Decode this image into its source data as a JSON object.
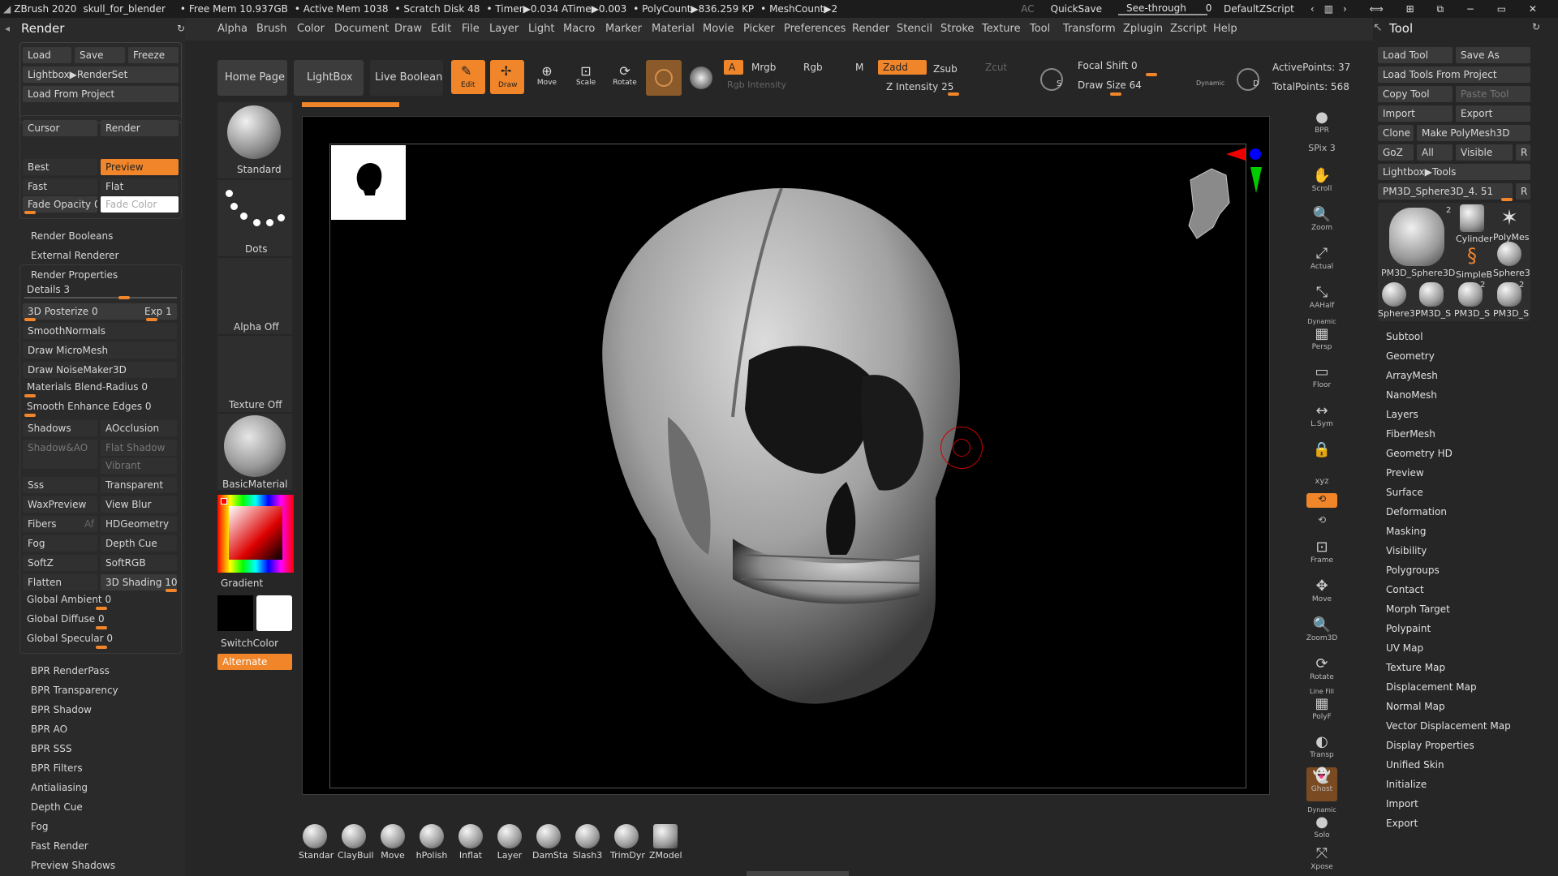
{
  "titlebar": {
    "items": [
      "ZBrush 2020",
      "skull_for_blender",
      "• Free Mem 10.937GB",
      "• Active Mem 1038",
      "• Scratch Disk 48",
      "• Timer▶0.034 ATime▶0.003",
      "• PolyCount▶836.259 KP",
      "• MeshCount▶2"
    ],
    "right": {
      "ac": "AC",
      "quicksave": "QuickSave",
      "see_through": "See-through",
      "see_through_val": "0",
      "script": "DefaultZScript"
    }
  },
  "menubar": [
    "Alpha",
    "Brush",
    "Color",
    "Document",
    "Draw",
    "Edit",
    "File",
    "Layer",
    "Light",
    "Macro",
    "Marker",
    "Material",
    "Movie",
    "Picker",
    "Preferences",
    "Render",
    "Stencil",
    "Stroke",
    "Texture",
    "Tool",
    "Transform",
    "Zplugin",
    "Zscript",
    "Help"
  ],
  "render_panel": {
    "title": "Render",
    "row1": [
      "Load",
      "Save",
      "Freeze"
    ],
    "lightbox": "Lightbox▶RenderSet",
    "load_from_project": "Load From Project",
    "cursor": "Cursor",
    "render": "Render",
    "best": "Best",
    "preview": "Preview",
    "fast": "Fast",
    "flat": "Flat",
    "fade_opacity": "Fade Opacity 0",
    "fade_color": "Fade Color",
    "render_booleans": "Render Booleans",
    "external_renderer": "External Renderer",
    "render_properties": "Render Properties",
    "details": "Details 3",
    "posterize": "3D Posterize 0",
    "exp": "Exp 1",
    "smooth_normals": "SmoothNormals",
    "draw_micromesh": "Draw MicroMesh",
    "draw_noisemaker": "Draw NoiseMaker3D",
    "materials_blend": "Materials Blend-Radius 0",
    "smooth_enhance": "Smooth Enhance Edges 0",
    "shadows": "Shadows",
    "aocclusion": "AOcclusion",
    "shadow_ao": "Shadow&AO",
    "flat_shadow": "Flat Shadow",
    "vibrant": "Vibrant",
    "sss": "Sss",
    "transparent": "Transparent",
    "waxpreview": "WaxPreview",
    "view_blur": "View Blur",
    "fibers": "Fibers",
    "af": "Af",
    "hdgeometry": "HDGeometry",
    "fog": "Fog",
    "depth_cue": "Depth Cue",
    "softz": "SoftZ",
    "softrgb": "SoftRGB",
    "flatten": "Flatten",
    "shading": "3D Shading 100",
    "global_ambient": "Global Ambient 0",
    "global_diffuse": "Global Diffuse 0",
    "global_specular": "Global Specular 0",
    "sections": [
      "BPR RenderPass",
      "BPR Transparency",
      "BPR Shadow",
      "BPR AO",
      "BPR SSS",
      "BPR Filters",
      "Antialiasing",
      "Depth Cue",
      "Fog",
      "Fast Render",
      "Preview Shadows"
    ]
  },
  "shelf": {
    "home": "Home Page",
    "lightbox": "LightBox",
    "live_boolean": "Live Boolean",
    "edit": "Edit",
    "draw": "Draw",
    "move": "Move",
    "scale": "Scale",
    "rotate": "Rotate",
    "a": "A",
    "mrgb": "Mrgb",
    "rgb": "Rgb",
    "m": "M",
    "zadd": "Zadd",
    "zsub": "Zsub",
    "zcut": "Zcut",
    "rgb_intensity": "Rgb Intensity",
    "z_intensity": "Z Intensity 25",
    "focal_shift": "Focal Shift 0",
    "draw_size": "Draw Size 64",
    "dynamic": "Dynamic",
    "active_points": "ActivePoints: 37",
    "total_points": "TotalPoints: 568",
    "s": "S",
    "d": "D"
  },
  "left_strip": {
    "standard": "Standard",
    "dots": "Dots",
    "alpha_off": "Alpha Off",
    "texture_off": "Texture Off",
    "material": "BasicMaterial",
    "gradient": "Gradient",
    "switch_color": "SwitchColor",
    "alternate": "Alternate"
  },
  "bottom_brushes": [
    "Standar",
    "ClayBuil",
    "Move",
    "hPolish",
    "Inflat",
    "Layer",
    "DamSta",
    "Slash3",
    "TrimDyr",
    "ZModel"
  ],
  "right_tools": [
    {
      "icon": "BPR",
      "label": ""
    },
    {
      "icon": "SPix 3",
      "label": ""
    },
    {
      "icon": "✋",
      "label": "Scroll"
    },
    {
      "icon": "🔍",
      "label": "Zoom"
    },
    {
      "icon": "⤢",
      "label": "Actual"
    },
    {
      "icon": "⤡",
      "label": "AAHalf"
    },
    {
      "icon": "Dynamic",
      "label": "Persp"
    },
    {
      "icon": "▭",
      "label": "Floor"
    },
    {
      "icon": "↔",
      "label": "L.Sym"
    },
    {
      "icon": "🔒",
      "label": ""
    },
    {
      "icon": "xyz",
      "label": ""
    },
    {
      "icon": "⟲",
      "label": ""
    },
    {
      "icon": "⊡",
      "label": "Frame"
    },
    {
      "icon": "✥",
      "label": "Move"
    },
    {
      "icon": "🔍",
      "label": "Zoom3D"
    },
    {
      "icon": "⟳",
      "label": "Rotate"
    },
    {
      "icon": "Line Fill",
      "label": "PolyF"
    },
    {
      "icon": "◐",
      "label": "Transp"
    },
    {
      "icon": "👻",
      "label": "Ghost"
    },
    {
      "icon": "Dynamic",
      "label": "Solo"
    },
    {
      "icon": "⤧",
      "label": "Xpose"
    }
  ],
  "tool_panel": {
    "title": "Tool",
    "load_tool": "Load Tool",
    "save_as": "Save As",
    "load_from_project": "Load Tools From Project",
    "copy_tool": "Copy Tool",
    "paste_tool": "Paste Tool",
    "import": "Import",
    "export": "Export",
    "clone": "Clone",
    "make_polymesh": "Make PolyMesh3D",
    "goz": "GoZ",
    "all": "All",
    "visible": "Visible",
    "r": "R",
    "lightbox_tools": "Lightbox▶Tools",
    "current_tool": "PM3D_Sphere3D_4. 51",
    "thumbs": [
      "PM3D_Sphere3D",
      "Cylinder",
      "PolyMes",
      "SimpleB",
      "Sphere3",
      "Sphere3",
      "PM3D_S",
      "PM3D_S",
      "PM3D_S"
    ],
    "badges": [
      "2",
      "2",
      "2"
    ],
    "sections": [
      "Subtool",
      "Geometry",
      "ArrayMesh",
      "NanoMesh",
      "Layers",
      "FiberMesh",
      "Geometry HD",
      "Preview",
      "Surface",
      "Deformation",
      "Masking",
      "Visibility",
      "Polygroups",
      "Contact",
      "Morph Target",
      "Polypaint",
      "UV Map",
      "Texture Map",
      "Displacement Map",
      "Normal Map",
      "Vector Displacement Map",
      "Display Properties",
      "Unified Skin",
      "Initialize",
      "Import",
      "Export"
    ]
  },
  "colors": {
    "accent": "#f0852a",
    "bg": "#262626",
    "panel": "#2a2a2a"
  }
}
